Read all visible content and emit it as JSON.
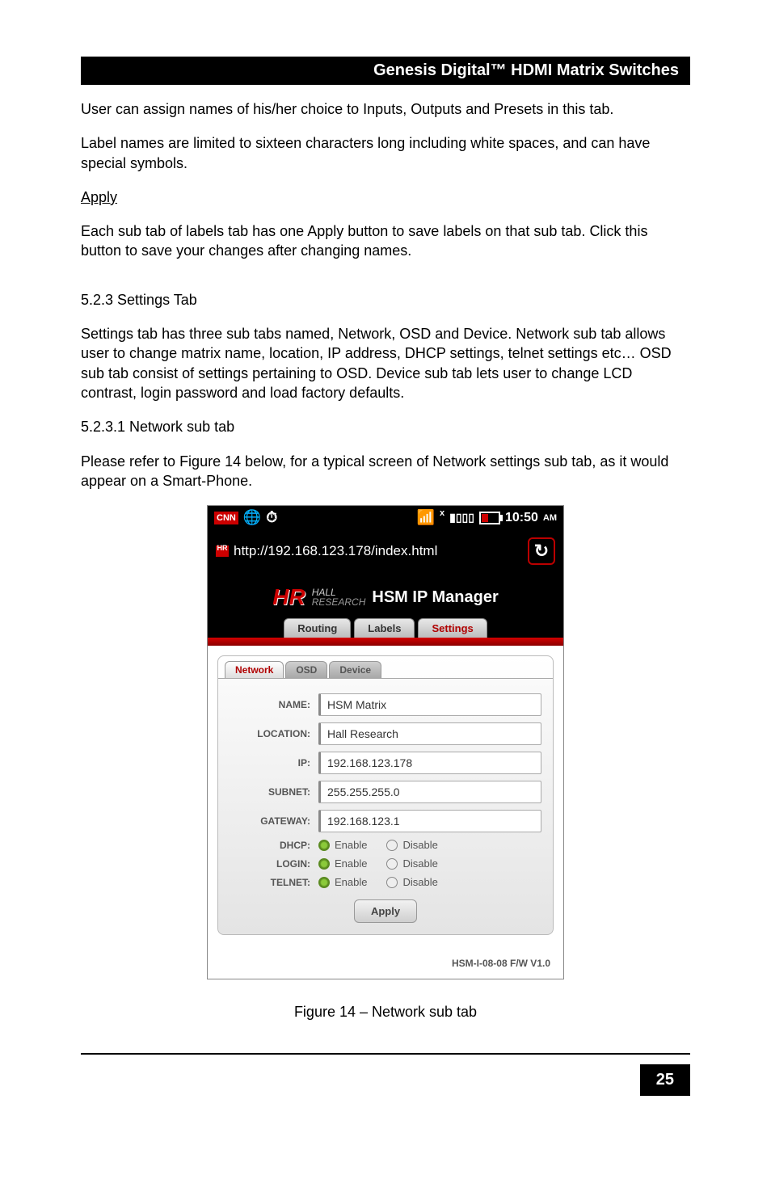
{
  "header": {
    "title": "Genesis Digital™ HDMI Matrix Switches"
  },
  "para1": "User can assign names of his/her choice to Inputs, Outputs and Presets in this tab.",
  "para2": "Label names are limited to sixteen characters long including white spaces, and can have special symbols.",
  "apply_heading": "Apply",
  "para3": "Each sub tab of labels tab has one Apply button to save labels on that sub tab. Click this button to save your changes after changing names.",
  "sec523": "5.2.3 Settings Tab",
  "para4": "Settings tab has three sub tabs named, Network, OSD and Device. Network sub tab allows user to change matrix name, location, IP address, DHCP settings, telnet settings etc… OSD sub tab consist of settings pertaining to OSD. Device sub tab lets user to change LCD contrast, login password and load factory defaults.",
  "sec5231": "5.2.3.1 Network sub tab",
  "para5": "Please refer to Figure 14 below, for a typical screen of Network settings sub tab, as it would appear on a Smart-Phone.",
  "phone": {
    "status": {
      "cnn": "CNN",
      "time": "10:50",
      "ampm": "AM"
    },
    "url": "http://192.168.123.178/index.html",
    "brand_sub1": "HALL",
    "brand_sub2": "RESEARCH",
    "app_title": "HSM IP Manager",
    "tabs": {
      "routing": "Routing",
      "labels": "Labels",
      "settings": "Settings"
    },
    "subtabs": {
      "network": "Network",
      "osd": "OSD",
      "device": "Device"
    },
    "form": {
      "name_label": "NAME:",
      "name_value": "HSM Matrix",
      "location_label": "LOCATION:",
      "location_value": "Hall Research",
      "ip_label": "IP:",
      "ip_value": "192.168.123.178",
      "subnet_label": "SUBNET:",
      "subnet_value": "255.255.255.0",
      "gateway_label": "GATEWAY:",
      "gateway_value": "192.168.123.1",
      "dhcp_label": "DHCP:",
      "login_label": "LOGIN:",
      "telnet_label": "TELNET:",
      "enable": "Enable",
      "disable": "Disable",
      "apply": "Apply"
    },
    "fw": "HSM-I-08-08 F/W V1.0"
  },
  "caption": "Figure 14 – Network sub tab",
  "page_number": "25"
}
